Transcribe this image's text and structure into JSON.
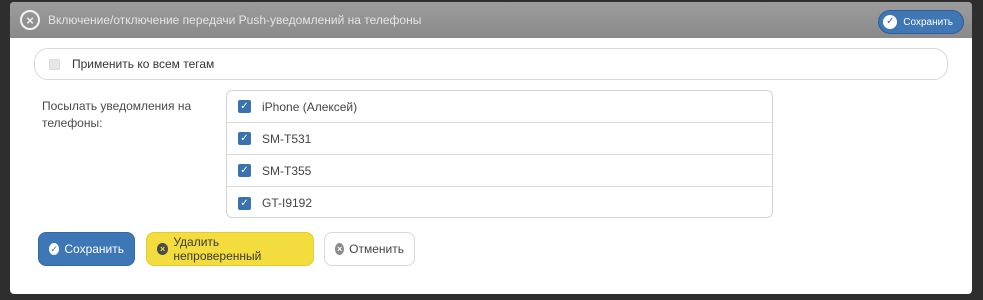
{
  "dialog": {
    "title": "Включение/отключение передачи Push-уведомлений на телефоны",
    "title_save_label": "Сохранить"
  },
  "apply_all": {
    "label": "Применить ко всем тегам",
    "checked": false
  },
  "send_to": {
    "label": "Посылать уведомления на телефоны:",
    "phones": [
      {
        "label": "iPhone (Алексей)",
        "checked": true
      },
      {
        "label": "SM-T531",
        "checked": true
      },
      {
        "label": "SM-T355",
        "checked": true
      },
      {
        "label": "GT-I9192",
        "checked": true
      }
    ]
  },
  "footer": {
    "save_label": "Сохранить",
    "delete_label": "Удалить непроверенный",
    "cancel_label": "Отменить"
  },
  "colors": {
    "primary": "#3d77b6",
    "warning": "#f3dd3e",
    "titlebar": "#9c9c9c"
  },
  "icons": {
    "close": "close-circle-icon",
    "save": "check-circle-icon",
    "delete": "x-circle-icon",
    "cancel": "x-circle-icon"
  }
}
